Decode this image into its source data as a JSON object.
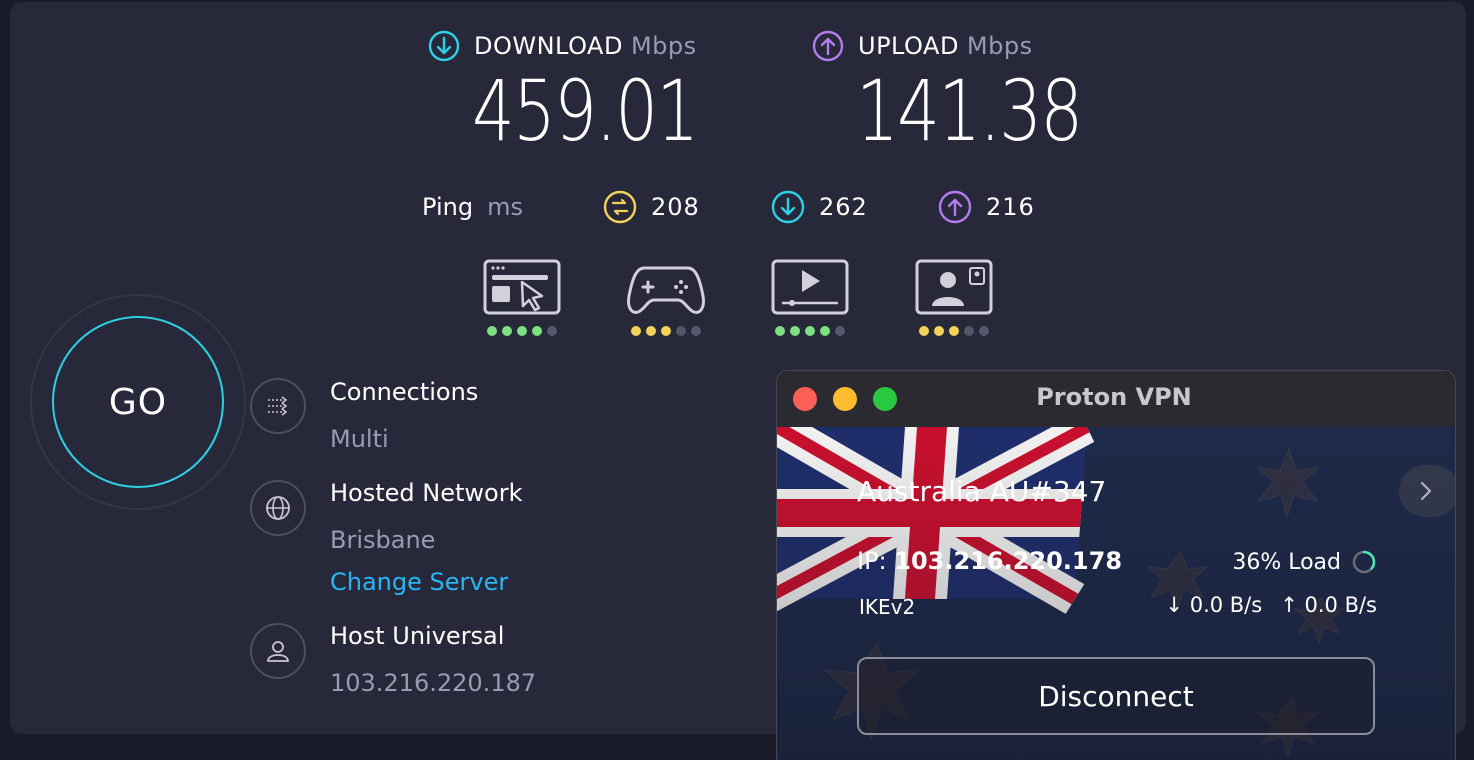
{
  "speedtest": {
    "download": {
      "label": "DOWNLOAD",
      "unit": "Mbps",
      "value": "459.01",
      "color": "#2ed0e6"
    },
    "upload": {
      "label": "UPLOAD",
      "unit": "Mbps",
      "value": "141.38",
      "color": "#b57cf0"
    },
    "ping": {
      "label": "Ping",
      "unit": "ms",
      "idle": "208",
      "download": "262",
      "upload": "216",
      "idle_color": "#f2d35b",
      "download_color": "#2ed0e6",
      "upload_color": "#b57cf0"
    },
    "activities": [
      {
        "name": "web-browsing",
        "rating": 4,
        "color": "#7ee081"
      },
      {
        "name": "gaming",
        "rating": 3,
        "color": "#f2d35b"
      },
      {
        "name": "streaming",
        "rating": 4,
        "color": "#7ee081"
      },
      {
        "name": "video-calls",
        "rating": 3,
        "color": "#f2d35b"
      }
    ],
    "go_label": "GO",
    "connections": {
      "title": "Connections",
      "value": "Multi"
    },
    "hosted_network": {
      "title": "Hosted Network",
      "value": "Brisbane",
      "change_label": "Change Server"
    },
    "host": {
      "title": "Host Universal",
      "value": "103.216.220.187"
    }
  },
  "proton": {
    "window_title": "Proton VPN",
    "server_name": "Australia AU#347",
    "ip_label": "IP:",
    "ip": "103.216.220.178",
    "load": "36% Load",
    "load_fraction": 0.36,
    "protocol": "IKEv2",
    "down_rate": "0.0 B/s",
    "up_rate": "0.0 B/s",
    "disconnect_label": "Disconnect",
    "traffic_lights": [
      "#fe5f57",
      "#febc2e",
      "#28c840"
    ]
  }
}
